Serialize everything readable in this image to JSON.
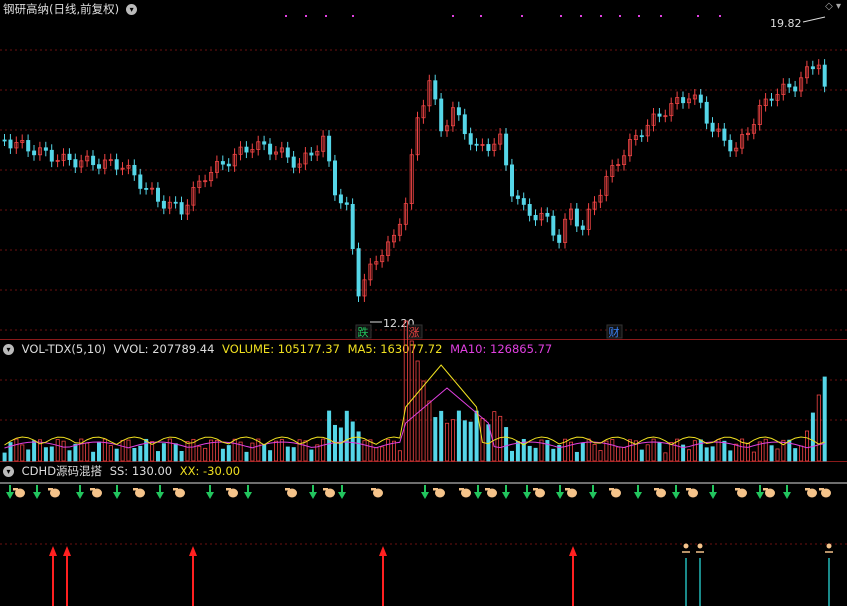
{
  "title": "钢研高纳",
  "period": "(日线,前复权)",
  "price_high_label": "19.82",
  "price_low_label": "12.20",
  "event_marks": [
    {
      "text": "跌",
      "color": "#22c55e"
    },
    {
      "text": "涨",
      "color": "#ef4444"
    },
    {
      "text": "财",
      "color": "#3b82f6"
    }
  ],
  "vol_panel": {
    "name": "VOL-TDX(5,10)",
    "vvol": "VVOL: 207789.44",
    "volume": "VOLUME: 105177.37",
    "ma5": "MA5: 163077.72",
    "ma10": "MA10: 126865.77",
    "colors": {
      "name": "#dddddd",
      "vvol": "#dddddd",
      "volume": "#f0e020",
      "ma5": "#f0e020",
      "ma10": "#e040e0"
    }
  },
  "cdhd_panel": {
    "name": "CDHD源码混搭",
    "ss": "SS: 130.00",
    "xx": "XX: -30.00",
    "colors": {
      "name": "#dddddd",
      "ss": "#dddddd",
      "xx": "#f0e020"
    }
  },
  "icons": [
    "settings-icon",
    "expand-icon"
  ],
  "colors": {
    "up": "#ef4444",
    "down": "#55d6e8",
    "grid": "#6b1010",
    "ma5": "#f0e020",
    "ma10": "#e040e0"
  }
}
